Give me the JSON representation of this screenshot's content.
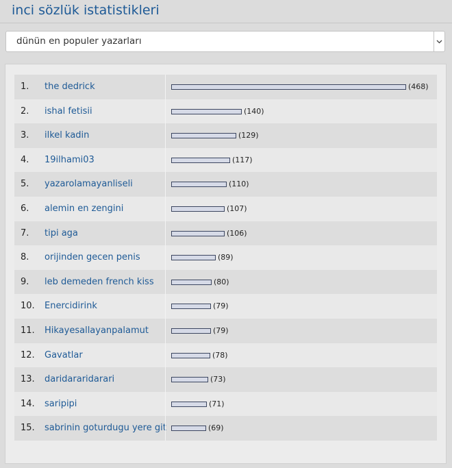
{
  "page": {
    "title": "inci sözlük istatistikleri"
  },
  "filter": {
    "selected": "dünün en populer yazarları",
    "dropdown_icon": "chevron-down-icon"
  },
  "colors": {
    "title": "#1e5a96",
    "link": "#1e5a96",
    "bar_fill": "#d6dae7",
    "bar_border": "#3c4660"
  },
  "ranking": {
    "max_value": 468,
    "rows": [
      {
        "rank": "1.",
        "name": "the dedrick",
        "count_label": "(468)",
        "value": 468
      },
      {
        "rank": "2.",
        "name": "ishal fetisii",
        "count_label": "(140)",
        "value": 140
      },
      {
        "rank": "3.",
        "name": "ilkel kadin",
        "count_label": "(129)",
        "value": 129
      },
      {
        "rank": "4.",
        "name": "19ilhami03",
        "count_label": "(117)",
        "value": 117
      },
      {
        "rank": "5.",
        "name": "yazarolamayanliseli",
        "count_label": "(110)",
        "value": 110
      },
      {
        "rank": "6.",
        "name": "alemin en zengini",
        "count_label": "(107)",
        "value": 107
      },
      {
        "rank": "7.",
        "name": "tipi aga",
        "count_label": "(106)",
        "value": 106
      },
      {
        "rank": "8.",
        "name": "orijinden gecen penis",
        "count_label": "(89)",
        "value": 89
      },
      {
        "rank": "9.",
        "name": "leb demeden french kiss",
        "count_label": "(80)",
        "value": 80
      },
      {
        "rank": "10.",
        "name": "Enercidirink",
        "count_label": "(79)",
        "value": 79
      },
      {
        "rank": "11.",
        "name": "Hikayesallayanpalamut",
        "count_label": "(79)",
        "value": 79
      },
      {
        "rank": "12.",
        "name": "Gavatlar",
        "count_label": "(78)",
        "value": 78
      },
      {
        "rank": "13.",
        "name": "daridararidarari",
        "count_label": "(73)",
        "value": 73
      },
      {
        "rank": "14.",
        "name": "saripipi",
        "count_label": "(71)",
        "value": 71
      },
      {
        "rank": "15.",
        "name": "sabrinin goturdugu yere git",
        "count_label": "(69)",
        "value": 69
      }
    ]
  }
}
